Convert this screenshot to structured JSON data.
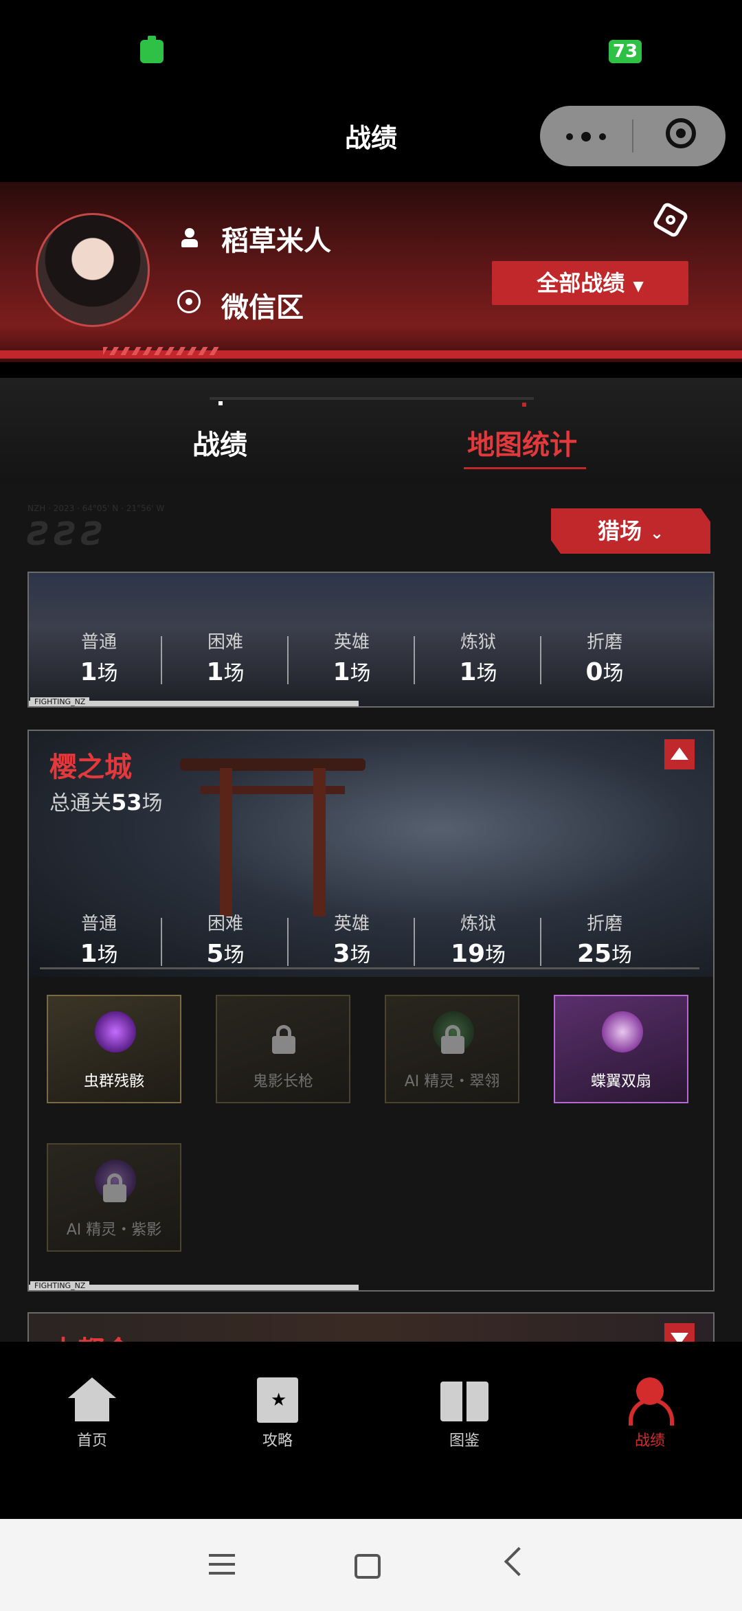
{
  "status_bar": {
    "battery_right": "73"
  },
  "header": {
    "title": "战绩"
  },
  "profile": {
    "user_name": "稻草米人",
    "region": "微信区",
    "all_records_label": "全部战绩"
  },
  "tabs": [
    {
      "label": "战绩",
      "active": false
    },
    {
      "label": "地图统计",
      "active": true
    }
  ],
  "filter": {
    "label": "猎场"
  },
  "decor": {
    "logo_text": "ƧƧƧ",
    "logo_sub": "NZH · 2023 · 64°05' N · 21°56' W"
  },
  "top_card": {
    "footer_label": "FIGHTING_NZ",
    "stats": [
      {
        "label": "普通",
        "count": "1",
        "unit": "场"
      },
      {
        "label": "困难",
        "count": "1",
        "unit": "场"
      },
      {
        "label": "英雄",
        "count": "1",
        "unit": "场"
      },
      {
        "label": "炼狱",
        "count": "1",
        "unit": "场"
      },
      {
        "label": "折磨",
        "count": "0",
        "unit": "场"
      }
    ]
  },
  "map_card": {
    "name": "樱之城",
    "clear_prefix": "总通关",
    "clear_count": "53",
    "clear_unit": "场",
    "footer_label": "FIGHTING_NZ",
    "stats": [
      {
        "label": "普通",
        "count": "1",
        "unit": "场"
      },
      {
        "label": "困难",
        "count": "5",
        "unit": "场"
      },
      {
        "label": "英雄",
        "count": "3",
        "unit": "场"
      },
      {
        "label": "炼狱",
        "count": "19",
        "unit": "场"
      },
      {
        "label": "折磨",
        "count": "25",
        "unit": "场"
      }
    ],
    "items": [
      {
        "name": "虫群残骸",
        "locked": false,
        "rarity": "gold"
      },
      {
        "name": "鬼影长枪",
        "locked": true,
        "rarity": "gold"
      },
      {
        "name": "AI 精灵・翠翎",
        "locked": true,
        "rarity": "gold"
      },
      {
        "name": "蝶翼双扇",
        "locked": false,
        "rarity": "purple"
      },
      {
        "name": "AI 精灵・紫影",
        "locked": true,
        "rarity": "gold"
      }
    ]
  },
  "next_card": {
    "name": "大都会"
  },
  "bottom_nav": [
    {
      "label": "首页",
      "icon": "home-icon"
    },
    {
      "label": "攻略",
      "icon": "guide-book-icon"
    },
    {
      "label": "图鉴",
      "icon": "open-book-icon"
    },
    {
      "label": "战绩",
      "icon": "user-icon",
      "active": true
    }
  ],
  "colors": {
    "accent": "#c0282b",
    "accent_text": "#e2393c",
    "battery": "#2fc046"
  }
}
